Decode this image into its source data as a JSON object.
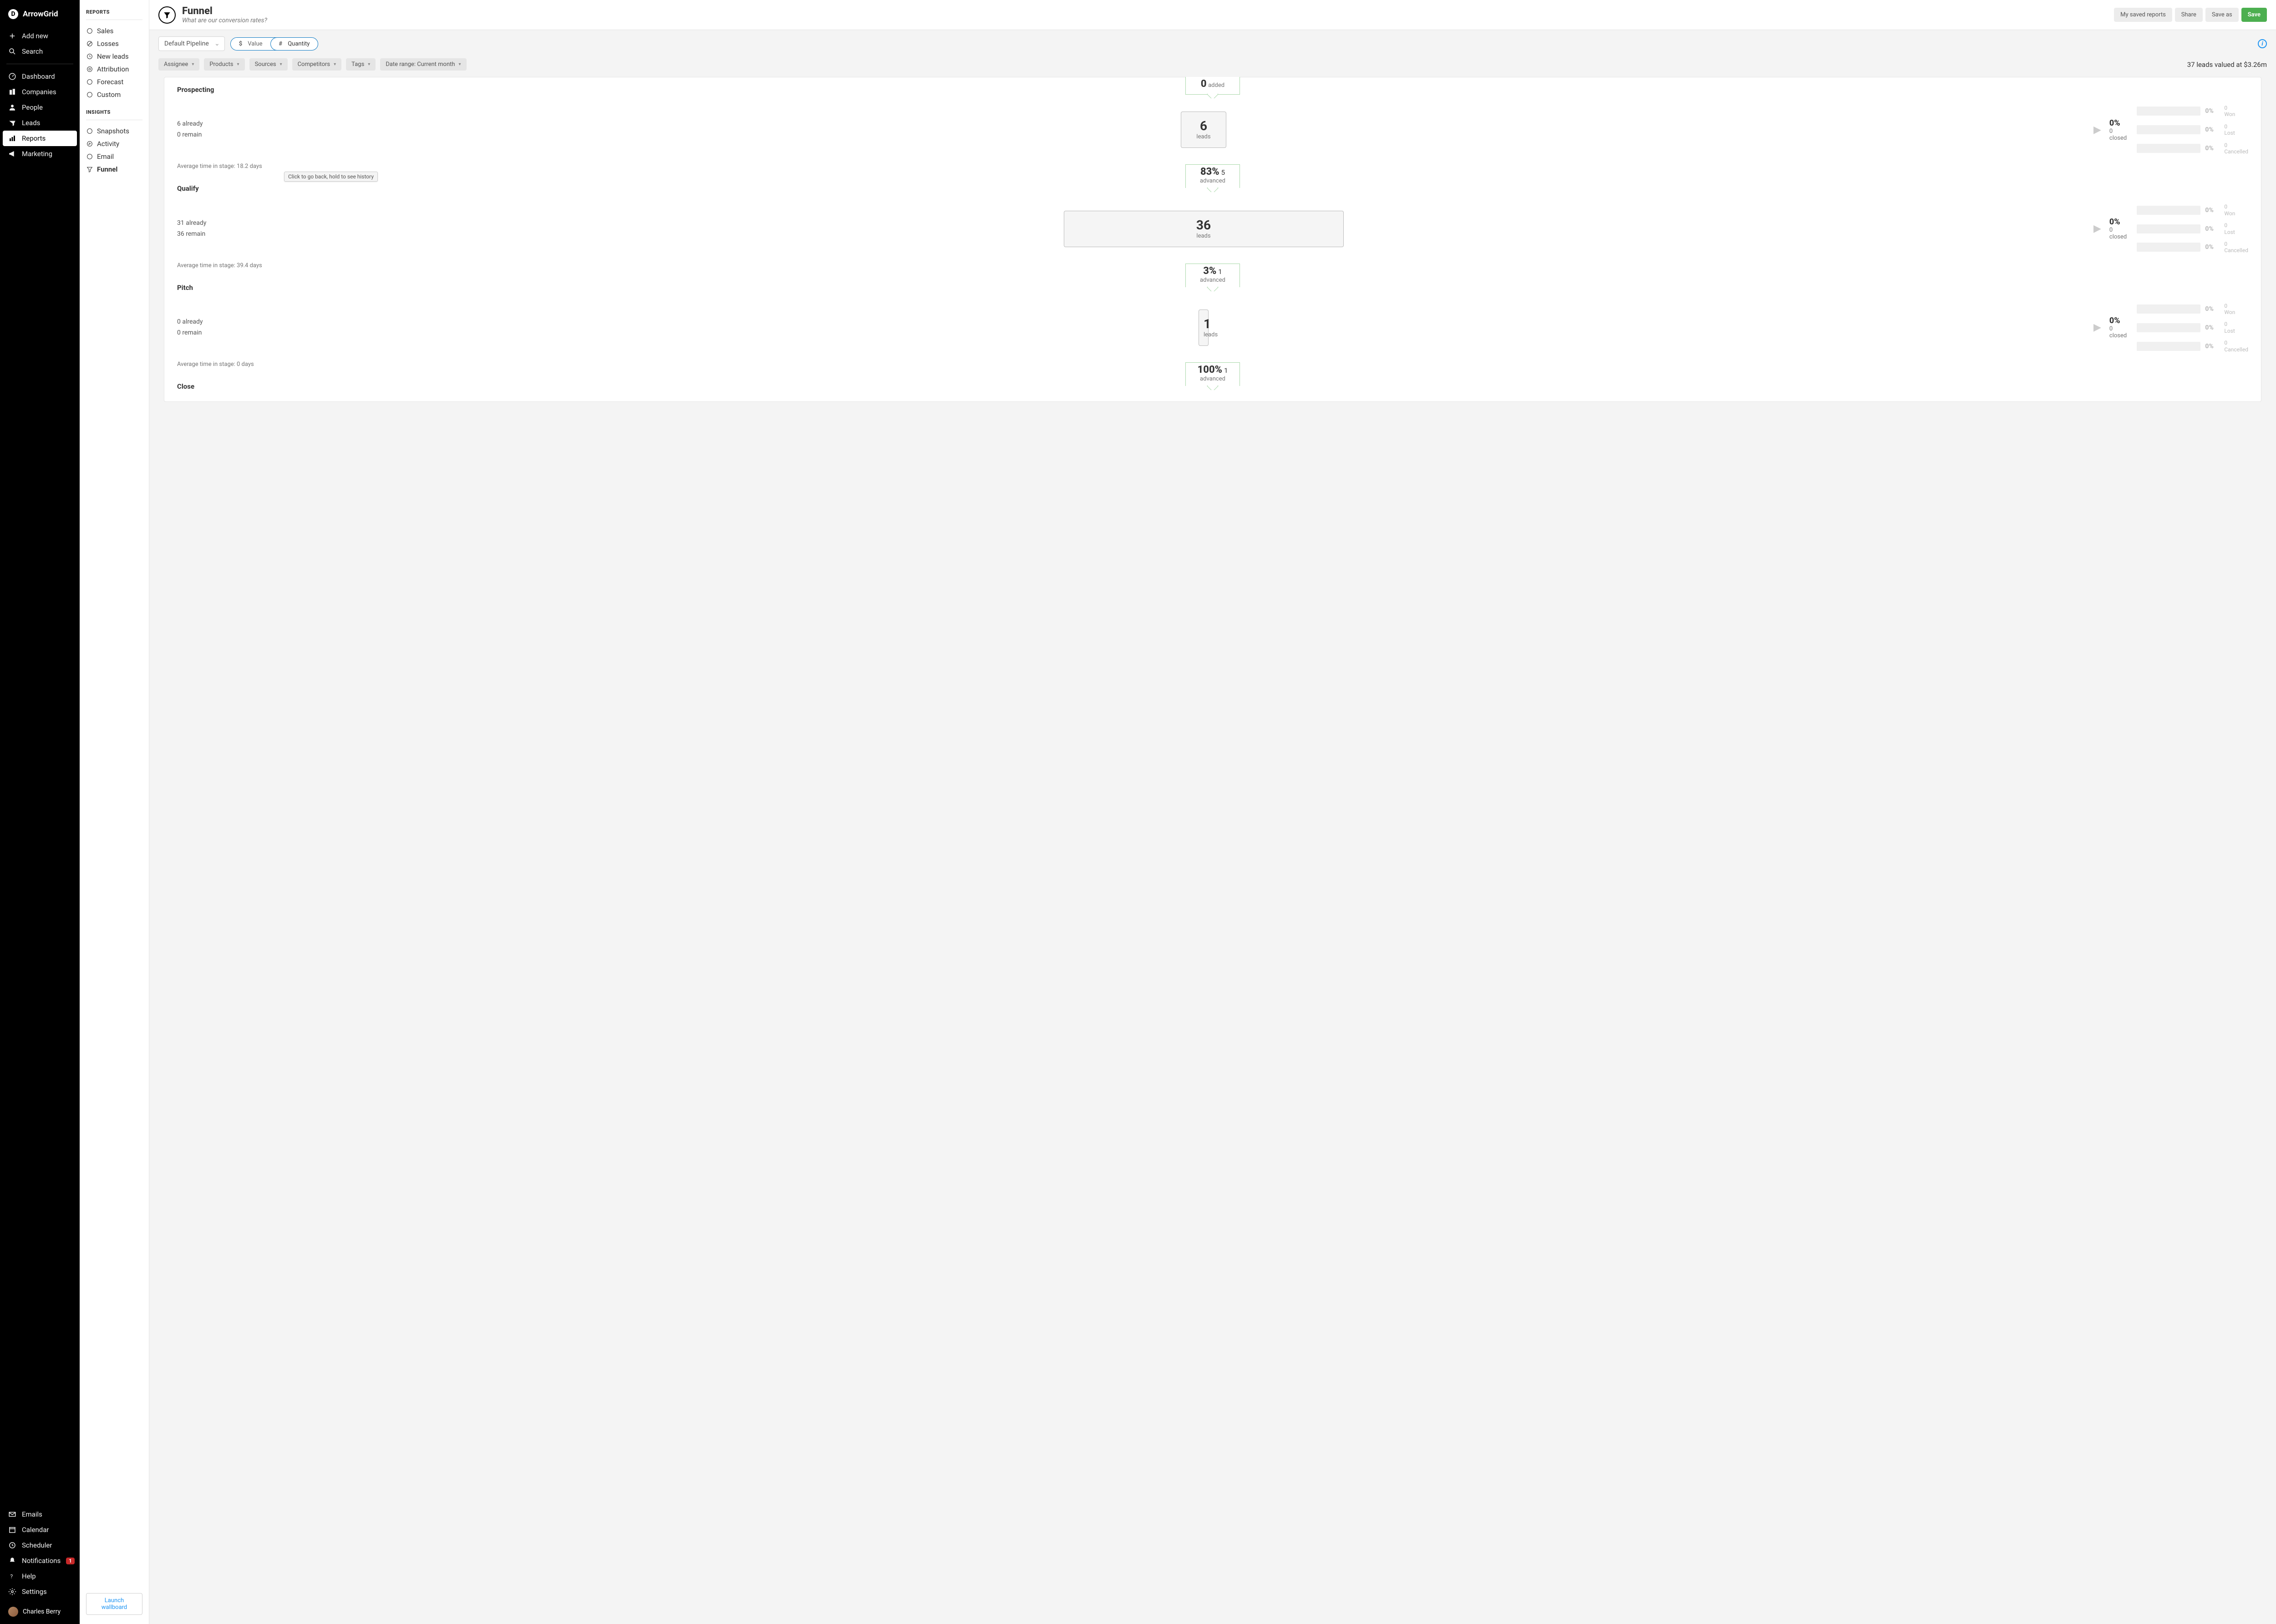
{
  "brand": "ArrowGrid",
  "sidebar": {
    "add_new": "Add new",
    "search": "Search",
    "dashboard": "Dashboard",
    "companies": "Companies",
    "people": "People",
    "leads": "Leads",
    "reports": "Reports",
    "marketing": "Marketing",
    "emails": "Emails",
    "calendar": "Calendar",
    "scheduler": "Scheduler",
    "notifications": "Notifications",
    "notifications_badge": "1",
    "help": "Help",
    "settings": "Settings",
    "user": "Charles Berry"
  },
  "subbar": {
    "reports_heading": "REPORTS",
    "sales": "Sales",
    "losses": "Losses",
    "new_leads": "New leads",
    "attribution": "Attribution",
    "forecast": "Forecast",
    "custom": "Custom",
    "insights_heading": "INSIGHTS",
    "snapshots": "Snapshots",
    "activity": "Activity",
    "email": "Email",
    "funnel": "Funnel",
    "launch": "Launch wallboard"
  },
  "header": {
    "title": "Funnel",
    "subtitle": "What are our conversion rates?",
    "my_saved": "My saved reports",
    "share": "Share",
    "save_as": "Save as",
    "save": "Save"
  },
  "filter": {
    "pipeline": "Default Pipeline",
    "value_sym": "$",
    "value": "Value",
    "qty_sym": "#",
    "qty": "Quantity",
    "assignee": "Assignee",
    "products": "Products",
    "sources": "Sources",
    "competitors": "Competitors",
    "tags": "Tags",
    "date_range": "Date range: Current month",
    "summary": "37 leads valued at $3.26m"
  },
  "tooltip": "Click to go back, hold to see history",
  "outcomes": {
    "won": "Won",
    "lost": "Lost",
    "cancelled": "Cancelled",
    "zero_pct": "0%",
    "zero": "0"
  },
  "stages": [
    {
      "name": "Prospecting",
      "added_n": "0",
      "added_label": "added",
      "already": "6 already",
      "remain": "0 remain",
      "leads_n": "6",
      "leads_label": "leads",
      "closed_pct": "0%",
      "closed_label": "0 closed",
      "avg": "Average time in stage: 18.2 days",
      "adv_pct": "83%",
      "adv_n": "5",
      "adv_label": "advanced",
      "box_w": "w100"
    },
    {
      "name": "Qualify",
      "already": "31 already",
      "remain": "36 remain",
      "leads_n": "36",
      "leads_label": "leads",
      "closed_pct": "0%",
      "closed_label": "0 closed",
      "avg": "Average time in stage: 39.4 days",
      "adv_pct": "3%",
      "adv_n": "1",
      "adv_label": "advanced",
      "box_w": "w615"
    },
    {
      "name": "Pitch",
      "already": "0 already",
      "remain": "0 remain",
      "leads_n": "1",
      "leads_label": "leads",
      "closed_pct": "0%",
      "closed_label": "0 closed",
      "avg": "Average time in stage: 0 days",
      "adv_pct": "100%",
      "adv_n": "1",
      "adv_label": "advanced",
      "box_w": "w18"
    },
    {
      "name": "Close"
    }
  ]
}
